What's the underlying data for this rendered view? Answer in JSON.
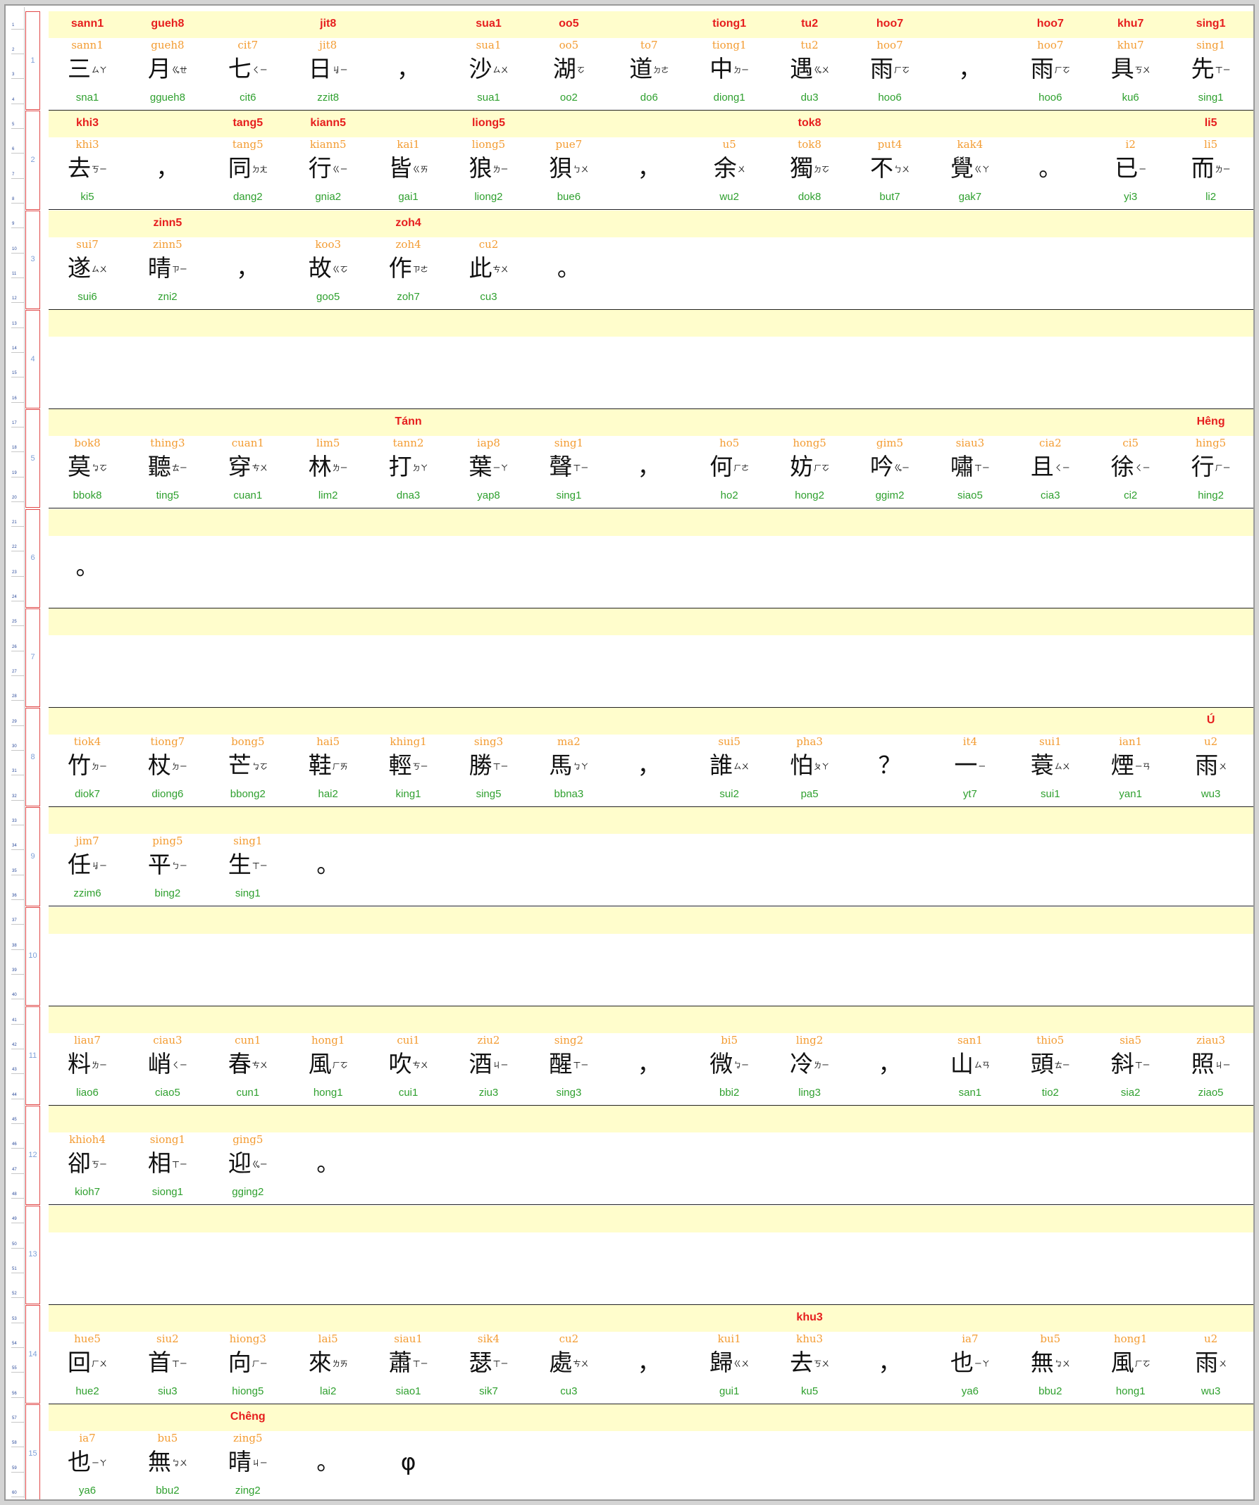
{
  "rows": [
    {
      "no": "1",
      "cells": [
        {
          "t": "sann1",
          "p": "sann1",
          "h": "三",
          "z": "ㄙㄚ",
          "m": "sna1"
        },
        {
          "t": "gueh8",
          "p": "gueh8",
          "h": "月",
          "z": "ㆣㄝ",
          "m": "ggueh8"
        },
        {
          "t": "",
          "p": "cit7",
          "h": "七",
          "z": "ㄑㄧ",
          "m": "cit6"
        },
        {
          "t": "jit8",
          "p": "jit8",
          "h": "日",
          "z": "ㆢㄧ",
          "m": "zzit8"
        },
        {
          "t": "",
          "p": "",
          "h": "，",
          "z": "",
          "m": ""
        },
        {
          "t": "sua1",
          "p": "sua1",
          "h": "沙",
          "z": "ㄙㄨ",
          "m": "sua1"
        },
        {
          "t": "oo5",
          "p": "oo5",
          "h": "湖",
          "z": "ㆦ",
          "m": "oo2"
        },
        {
          "t": "",
          "p": "to7",
          "h": "道",
          "z": "ㄉㄜ",
          "m": "do6"
        },
        {
          "t": "tiong1",
          "p": "tiong1",
          "h": "中",
          "z": "ㄉㄧ",
          "m": "diong1"
        },
        {
          "t": "tu2",
          "p": "tu2",
          "h": "遇",
          "z": "ㆣㄨ",
          "m": "du3"
        },
        {
          "t": "hoo7",
          "p": "hoo7",
          "h": "雨",
          "z": "ㄏㆦ",
          "m": "hoo6"
        },
        {
          "t": "",
          "p": "",
          "h": "，",
          "z": "",
          "m": ""
        },
        {
          "t": "hoo7",
          "p": "hoo7",
          "h": "雨",
          "z": "ㄏㆦ",
          "m": "hoo6"
        },
        {
          "t": "khu7",
          "p": "khu7",
          "h": "具",
          "z": "ㄎㄨ",
          "m": "ku6"
        },
        {
          "t": "sing1",
          "p": "sing1",
          "h": "先",
          "z": "ㄒㄧ",
          "m": "sing1"
        }
      ]
    },
    {
      "no": "2",
      "cells": [
        {
          "t": "khi3",
          "p": "khi3",
          "h": "去",
          "z": "ㄎㄧ",
          "m": "ki5"
        },
        {
          "t": "",
          "p": "",
          "h": "，",
          "z": "",
          "m": ""
        },
        {
          "t": "tang5",
          "p": "tang5",
          "h": "同",
          "z": "ㄉㄤ",
          "m": "dang2"
        },
        {
          "t": "kiann5",
          "p": "kiann5",
          "h": "行",
          "z": "ㄍㄧ",
          "m": "gnia2"
        },
        {
          "t": "",
          "p": "kai1",
          "h": "皆",
          "z": "ㄍㄞ",
          "m": "gai1"
        },
        {
          "t": "liong5",
          "p": "liong5",
          "h": "狼",
          "z": "ㄌㄧ",
          "m": "liong2"
        },
        {
          "t": "",
          "p": "pue7",
          "h": "狽",
          "z": "ㄅㄨ",
          "m": "bue6"
        },
        {
          "t": "",
          "p": "",
          "h": "，",
          "z": "",
          "m": ""
        },
        {
          "t": "",
          "p": "u5",
          "h": "余",
          "z": "ㄨ",
          "m": "wu2"
        },
        {
          "t": "tok8",
          "p": "tok8",
          "h": "獨",
          "z": "ㄉㆦ",
          "m": "dok8"
        },
        {
          "t": "",
          "p": "put4",
          "h": "不",
          "z": "ㄅㄨ",
          "m": "but7"
        },
        {
          "t": "",
          "p": "kak4",
          "h": "覺",
          "z": "ㄍㄚ",
          "m": "gak7"
        },
        {
          "t": "",
          "p": "",
          "h": "。",
          "z": "",
          "m": ""
        },
        {
          "t": "",
          "p": "i2",
          "h": "已",
          "z": "ㄧ",
          "m": "yi3"
        },
        {
          "t": "li5",
          "p": "li5",
          "h": "而",
          "z": "ㄌㄧ",
          "m": "li2"
        }
      ]
    },
    {
      "no": "3",
      "cells": [
        {
          "t": "",
          "p": "sui7",
          "h": "遂",
          "z": "ㄙㄨ",
          "m": "sui6"
        },
        {
          "t": "zinn5",
          "p": "zinn5",
          "h": "晴",
          "z": "ㄗㄧ",
          "m": "zni2"
        },
        {
          "t": "",
          "p": "",
          "h": "，",
          "z": "",
          "m": ""
        },
        {
          "t": "",
          "p": "koo3",
          "h": "故",
          "z": "ㄍㆦ",
          "m": "goo5"
        },
        {
          "t": "zoh4",
          "p": "zoh4",
          "h": "作",
          "z": "ㄗㄜ",
          "m": "zoh7"
        },
        {
          "t": "",
          "p": "cu2",
          "h": "此",
          "z": "ㄘㄨ",
          "m": "cu3"
        },
        {
          "t": "",
          "p": "",
          "h": "。",
          "z": "",
          "m": ""
        }
      ]
    },
    {
      "no": "4",
      "cells": []
    },
    {
      "no": "5",
      "cells": [
        {
          "t": "",
          "p": "bok8",
          "h": "莫",
          "z": "ㆠㆦ",
          "m": "bbok8"
        },
        {
          "t": "",
          "p": "thing3",
          "h": "聽",
          "z": "ㄊㄧ",
          "m": "ting5"
        },
        {
          "t": "",
          "p": "cuan1",
          "h": "穿",
          "z": "ㄘㄨ",
          "m": "cuan1"
        },
        {
          "t": "",
          "p": "lim5",
          "h": "林",
          "z": "ㄌㄧ",
          "m": "lim2"
        },
        {
          "t": "Tánn",
          "p": "tann2",
          "h": "打",
          "z": "ㄉㄚ",
          "m": "dna3"
        },
        {
          "t": "",
          "p": "iap8",
          "h": "葉",
          "z": "ㄧㄚ",
          "m": "yap8"
        },
        {
          "t": "",
          "p": "sing1",
          "h": "聲",
          "z": "ㄒㄧ",
          "m": "sing1"
        },
        {
          "t": "",
          "p": "",
          "h": "，",
          "z": "",
          "m": ""
        },
        {
          "t": "",
          "p": "ho5",
          "h": "何",
          "z": "ㄏㄜ",
          "m": "ho2"
        },
        {
          "t": "",
          "p": "hong5",
          "h": "妨",
          "z": "ㄏㆦ",
          "m": "hong2"
        },
        {
          "t": "",
          "p": "gim5",
          "h": "吟",
          "z": "ㆣㄧ",
          "m": "ggim2"
        },
        {
          "t": "",
          "p": "siau3",
          "h": "嘯",
          "z": "ㄒㄧ",
          "m": "siao5"
        },
        {
          "t": "",
          "p": "cia2",
          "h": "且",
          "z": "ㄑㄧ",
          "m": "cia3"
        },
        {
          "t": "",
          "p": "ci5",
          "h": "徐",
          "z": "ㄑㄧ",
          "m": "ci2"
        },
        {
          "t": "Hêng",
          "p": "hing5",
          "h": "行",
          "z": "ㄏㄧ",
          "m": "hing2"
        }
      ]
    },
    {
      "no": "6",
      "cells": [
        {
          "t": "",
          "p": "",
          "h": "。",
          "z": "",
          "m": ""
        }
      ]
    },
    {
      "no": "7",
      "cells": []
    },
    {
      "no": "8",
      "cells": [
        {
          "t": "",
          "p": "tiok4",
          "h": "竹",
          "z": "ㄉㄧ",
          "m": "diok7"
        },
        {
          "t": "",
          "p": "tiong7",
          "h": "杖",
          "z": "ㄉㄧ",
          "m": "diong6"
        },
        {
          "t": "",
          "p": "bong5",
          "h": "芒",
          "z": "ㆠㆦ",
          "m": "bbong2"
        },
        {
          "t": "",
          "p": "hai5",
          "h": "鞋",
          "z": "ㄏㄞ",
          "m": "hai2"
        },
        {
          "t": "",
          "p": "khing1",
          "h": "輕",
          "z": "ㄎㄧ",
          "m": "king1"
        },
        {
          "t": "",
          "p": "sing3",
          "h": "勝",
          "z": "ㄒㄧ",
          "m": "sing5"
        },
        {
          "t": "",
          "p": "ma2",
          "h": "馬",
          "z": "ㆠㄚ",
          "m": "bbna3"
        },
        {
          "t": "",
          "p": "",
          "h": "，",
          "z": "",
          "m": ""
        },
        {
          "t": "",
          "p": "sui5",
          "h": "誰",
          "z": "ㄙㄨ",
          "m": "sui2"
        },
        {
          "t": "",
          "p": "pha3",
          "h": "怕",
          "z": "ㄆㄚ",
          "m": "pa5"
        },
        {
          "t": "",
          "p": "",
          "h": "？",
          "z": "",
          "m": ""
        },
        {
          "t": "",
          "p": "it4",
          "h": "一",
          "z": "ㄧ",
          "m": "yt7"
        },
        {
          "t": "",
          "p": "sui1",
          "h": "蓑",
          "z": "ㄙㄨ",
          "m": "sui1"
        },
        {
          "t": "",
          "p": "ian1",
          "h": "煙",
          "z": "ㄧㄢ",
          "m": "yan1"
        },
        {
          "t": "Ú",
          "p": "u2",
          "h": "雨",
          "z": "ㄨ",
          "m": "wu3"
        }
      ]
    },
    {
      "no": "9",
      "cells": [
        {
          "t": "",
          "p": "jim7",
          "h": "任",
          "z": "ㆢㄧ",
          "m": "zzim6"
        },
        {
          "t": "",
          "p": "ping5",
          "h": "平",
          "z": "ㄅㄧ",
          "m": "bing2"
        },
        {
          "t": "",
          "p": "sing1",
          "h": "生",
          "z": "ㄒㄧ",
          "m": "sing1"
        },
        {
          "t": "",
          "p": "",
          "h": "。",
          "z": "",
          "m": ""
        }
      ]
    },
    {
      "no": "10",
      "cells": []
    },
    {
      "no": "11",
      "cells": [
        {
          "t": "",
          "p": "liau7",
          "h": "料",
          "z": "ㄌㄧ",
          "m": "liao6"
        },
        {
          "t": "",
          "p": "ciau3",
          "h": "峭",
          "z": "ㄑㄧ",
          "m": "ciao5"
        },
        {
          "t": "",
          "p": "cun1",
          "h": "春",
          "z": "ㄘㄨ",
          "m": "cun1"
        },
        {
          "t": "",
          "p": "hong1",
          "h": "風",
          "z": "ㄏㆦ",
          "m": "hong1"
        },
        {
          "t": "",
          "p": "cui1",
          "h": "吹",
          "z": "ㄘㄨ",
          "m": "cui1"
        },
        {
          "t": "",
          "p": "ziu2",
          "h": "酒",
          "z": "ㄐㄧ",
          "m": "ziu3"
        },
        {
          "t": "",
          "p": "sing2",
          "h": "醒",
          "z": "ㄒㄧ",
          "m": "sing3"
        },
        {
          "t": "",
          "p": "",
          "h": "，",
          "z": "",
          "m": ""
        },
        {
          "t": "",
          "p": "bi5",
          "h": "微",
          "z": "ㆠㄧ",
          "m": "bbi2"
        },
        {
          "t": "",
          "p": "ling2",
          "h": "冷",
          "z": "ㄌㄧ",
          "m": "ling3"
        },
        {
          "t": "",
          "p": "",
          "h": "，",
          "z": "",
          "m": ""
        },
        {
          "t": "",
          "p": "san1",
          "h": "山",
          "z": "ㄙㄢ",
          "m": "san1"
        },
        {
          "t": "",
          "p": "thio5",
          "h": "頭",
          "z": "ㄊㄧ",
          "m": "tio2"
        },
        {
          "t": "",
          "p": "sia5",
          "h": "斜",
          "z": "ㄒㄧ",
          "m": "sia2"
        },
        {
          "t": "",
          "p": "ziau3",
          "h": "照",
          "z": "ㄐㄧ",
          "m": "ziao5"
        }
      ]
    },
    {
      "no": "12",
      "cells": [
        {
          "t": "",
          "p": "khioh4",
          "h": "卻",
          "z": "ㄎㄧ",
          "m": "kioh7"
        },
        {
          "t": "",
          "p": "siong1",
          "h": "相",
          "z": "ㄒㄧ",
          "m": "siong1"
        },
        {
          "t": "",
          "p": "ging5",
          "h": "迎",
          "z": "ㆣㄧ",
          "m": "gging2"
        },
        {
          "t": "",
          "p": "",
          "h": "。",
          "z": "",
          "m": ""
        }
      ]
    },
    {
      "no": "13",
      "cells": []
    },
    {
      "no": "14",
      "cells": [
        {
          "t": "",
          "p": "hue5",
          "h": "回",
          "z": "ㄏㄨ",
          "m": "hue2"
        },
        {
          "t": "",
          "p": "siu2",
          "h": "首",
          "z": "ㄒㄧ",
          "m": "siu3"
        },
        {
          "t": "",
          "p": "hiong3",
          "h": "向",
          "z": "ㄏㄧ",
          "m": "hiong5"
        },
        {
          "t": "",
          "p": "lai5",
          "h": "來",
          "z": "ㄌㄞ",
          "m": "lai2"
        },
        {
          "t": "",
          "p": "siau1",
          "h": "蕭",
          "z": "ㄒㄧ",
          "m": "siao1"
        },
        {
          "t": "",
          "p": "sik4",
          "h": "瑟",
          "z": "ㄒㄧ",
          "m": "sik7"
        },
        {
          "t": "",
          "p": "cu2",
          "h": "處",
          "z": "ㄘㄨ",
          "m": "cu3"
        },
        {
          "t": "",
          "p": "",
          "h": "，",
          "z": "",
          "m": ""
        },
        {
          "t": "",
          "p": "kui1",
          "h": "歸",
          "z": "ㄍㄨ",
          "m": "gui1"
        },
        {
          "t": "khu3",
          "p": "khu3",
          "h": "去",
          "z": "ㄎㄨ",
          "m": "ku5"
        },
        {
          "t": "",
          "p": "",
          "h": "，",
          "z": "",
          "m": ""
        },
        {
          "t": "",
          "p": "ia7",
          "h": "也",
          "z": "ㄧㄚ",
          "m": "ya6"
        },
        {
          "t": "",
          "p": "bu5",
          "h": "無",
          "z": "ㆠㄨ",
          "m": "bbu2"
        },
        {
          "t": "",
          "p": "hong1",
          "h": "風",
          "z": "ㄏㆦ",
          "m": "hong1"
        },
        {
          "t": "",
          "p": "u2",
          "h": "雨",
          "z": "ㄨ",
          "m": "wu3"
        }
      ]
    },
    {
      "no": "15",
      "cells": [
        {
          "t": "",
          "p": "ia7",
          "h": "也",
          "z": "ㄧㄚ",
          "m": "ya6"
        },
        {
          "t": "",
          "p": "bu5",
          "h": "無",
          "z": "ㆠㄨ",
          "m": "bbu2"
        },
        {
          "t": "Chêng",
          "p": "zing5",
          "h": "晴",
          "z": "ㄐㄧ",
          "m": "zing2"
        },
        {
          "t": "",
          "p": "",
          "h": "。",
          "z": "",
          "m": ""
        },
        {
          "t": "",
          "p": "",
          "h": "φ",
          "z": "",
          "m": ""
        }
      ]
    }
  ]
}
